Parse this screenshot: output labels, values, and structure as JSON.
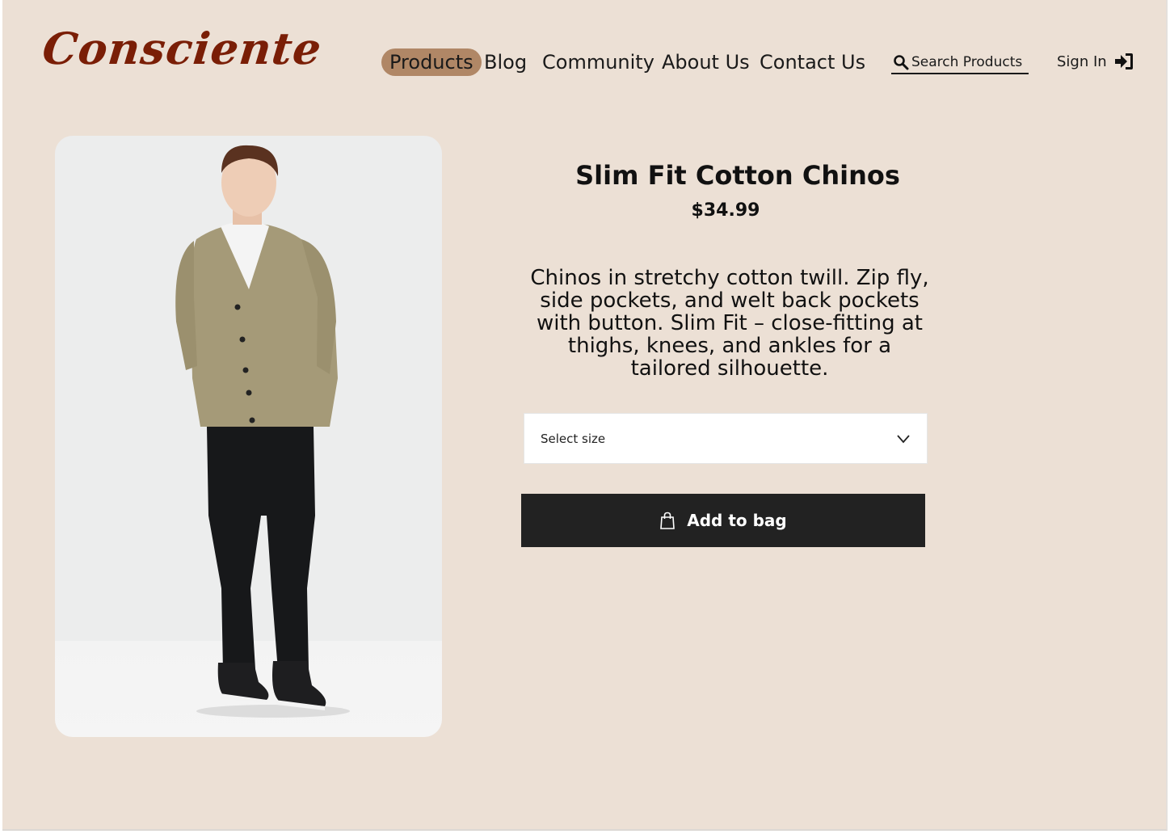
{
  "brand": {
    "logo_text": "Consciente",
    "logo_color": "#7a1e06"
  },
  "nav": {
    "items": [
      {
        "label": "Products",
        "active": true
      },
      {
        "label": "Blog",
        "active": false
      },
      {
        "label": "Community",
        "active": false
      },
      {
        "label": "About Us",
        "active": false
      },
      {
        "label": "Contact Us",
        "active": false
      }
    ],
    "active_color": "#b08766"
  },
  "search": {
    "placeholder": "Search Products",
    "icon": "search-icon"
  },
  "account": {
    "signin_label": "Sign In",
    "icon": "sign-in-icon"
  },
  "product": {
    "title": "Slim Fit Cotton Chinos",
    "price": "$34.99",
    "description": "Chinos in stretchy cotton twill. Zip fly, side pockets, and welt back pockets with button. Slim Fit – close-fitting at thighs, knees, and ankles for a tailored silhouette.",
    "size_select": {
      "label": "Select size",
      "icon": "chevron-down-icon"
    },
    "add_to_bag": {
      "label": "Add to bag",
      "icon": "shopping-bag-icon"
    },
    "image_subject": "model-photo"
  },
  "colors": {
    "background": "#ece0d5",
    "button_dark": "#222222"
  }
}
